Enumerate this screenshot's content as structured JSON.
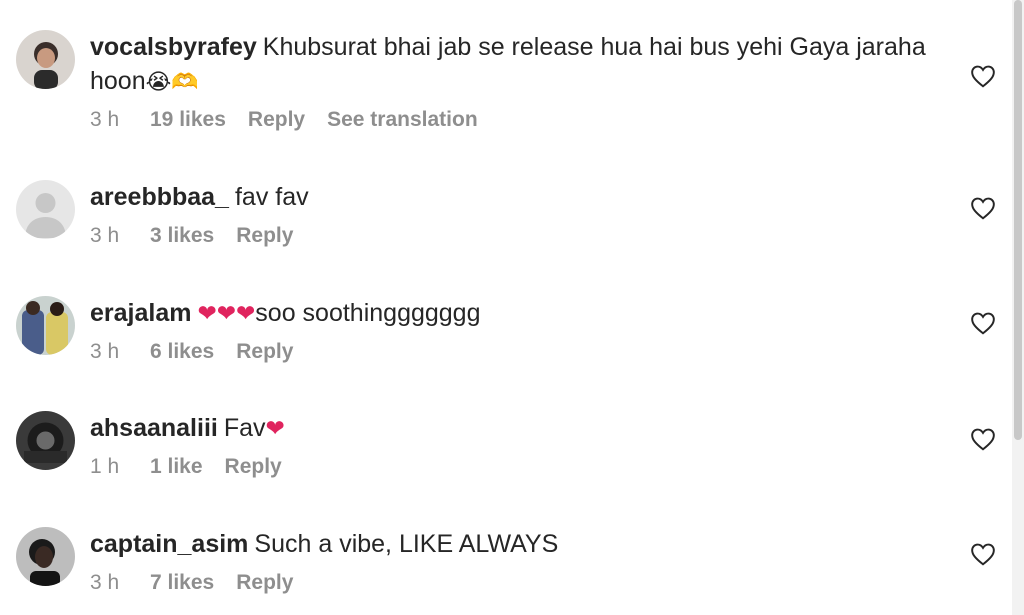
{
  "comments": [
    {
      "username": "vocalsbyrafey",
      "text": "Khubsurat bhai jab se release hua hai bus yehi Gaya jaraha hoon",
      "emoji": "😭🫶",
      "time": "3 h",
      "likes": "19 likes",
      "reply": "Reply",
      "translate": "See translation",
      "avatar": "photo-avatar"
    },
    {
      "username": "areebbbaa_",
      "text": "fav fav",
      "emoji": "",
      "time": "3 h",
      "likes": "3 likes",
      "reply": "Reply",
      "avatar": "default-avatar"
    },
    {
      "username": "erajalam",
      "text": "soo soothinggggggg",
      "emoji": "❤❤❤",
      "time": "3 h",
      "likes": "6 likes",
      "reply": "Reply",
      "avatar": "photo-avatar"
    },
    {
      "username": "ahsaanaliii",
      "text": "Fav",
      "emoji": "❤",
      "time": "1 h",
      "likes": "1 like",
      "reply": "Reply",
      "avatar": "photo-avatar"
    },
    {
      "username": "captain_asim",
      "text": "Such a vibe, LIKE ALWAYS",
      "emoji": "",
      "time": "3 h",
      "likes": "7 likes",
      "reply": "Reply",
      "avatar": "photo-avatar"
    }
  ],
  "colors": {
    "text": "#262626",
    "meta": "#8e8e8e",
    "heart": "#e0245e"
  },
  "icons": {
    "like": "heart-outline-icon"
  }
}
